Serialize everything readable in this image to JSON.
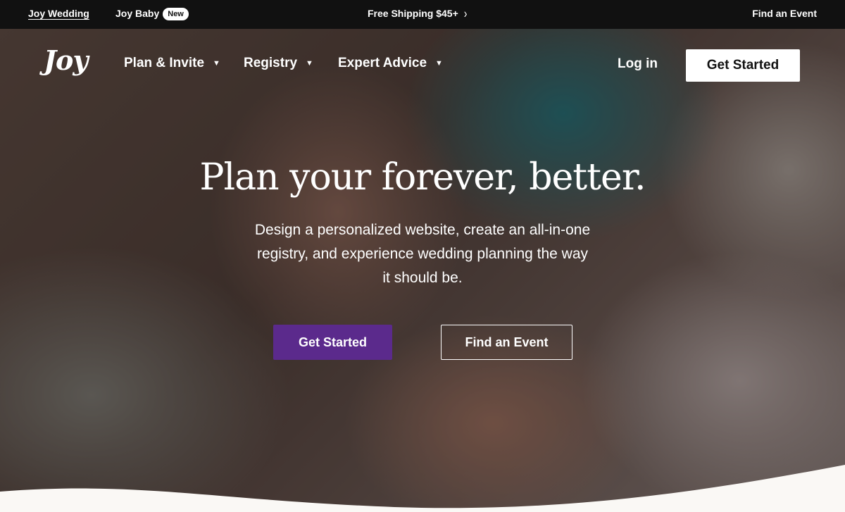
{
  "topbar": {
    "wedding": "Joy Wedding",
    "baby": "Joy Baby",
    "baby_badge": "New",
    "shipping": "Free Shipping $45+",
    "find_event": "Find an Event"
  },
  "nav": {
    "logo": "Joy",
    "items": [
      {
        "label": "Plan & Invite"
      },
      {
        "label": "Registry"
      },
      {
        "label": "Expert Advice"
      }
    ],
    "login": "Log in",
    "cta": "Get Started"
  },
  "hero": {
    "headline": "Plan your forever, better.",
    "subtext": "Design a personalized website, create an all-in-one registry, and experience wedding planning the way it should be.",
    "primary_button": "Get Started",
    "secondary_button": "Find an Event"
  },
  "colors": {
    "primary": "#5b2a8c",
    "topbar_bg": "#111111",
    "page_bg": "#faf8f5"
  }
}
